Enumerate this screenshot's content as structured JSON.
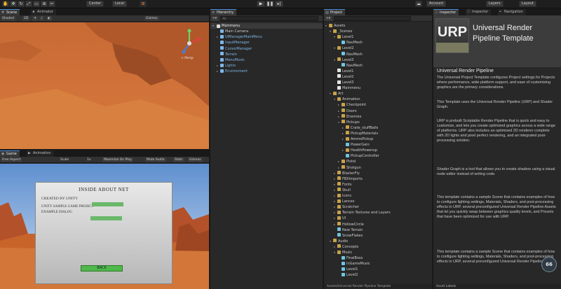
{
  "toolbar": {
    "left_buttons": [
      "Center",
      "Local"
    ],
    "right_buttons": [
      "Account",
      "Layers",
      "Layout"
    ]
  },
  "scene_panel": {
    "tabs": [
      "Scene",
      "Animator"
    ],
    "subbar": [
      "Shaded",
      "2D",
      "Gizmos"
    ],
    "gizmo_label": "< Persp"
  },
  "game_panel": {
    "tabs": [
      "Game",
      "Animation"
    ],
    "subbar": [
      "Free Aspect",
      "Scale",
      "1x",
      "Maximize On Play",
      "Mute Audio",
      "Stats",
      "Gizmos"
    ],
    "dialog": {
      "title": "INSIDE ABOUT NET",
      "line1": "CREATED BY UNITY",
      "line2": "UNITY SAMPLE GAME PROJECT",
      "line3": "EXAMPLE DIALOG",
      "button": "BACK"
    }
  },
  "hierarchy": {
    "tab": "Hierarchy",
    "search_placeholder": "All",
    "scene_name": "Mainmenu",
    "items": [
      {
        "label": "Main Camera",
        "depth": 1,
        "icon": "go",
        "arrow": ""
      },
      {
        "label": "UIManagerMainMenu",
        "depth": 1,
        "icon": "go",
        "arrow": "▸"
      },
      {
        "label": "InputManager",
        "depth": 1,
        "icon": "go",
        "arrow": ""
      },
      {
        "label": "CursorManager",
        "depth": 1,
        "icon": "go",
        "arrow": ""
      },
      {
        "label": "Terrain",
        "depth": 1,
        "icon": "go",
        "arrow": ""
      },
      {
        "label": "MenuMusic",
        "depth": 1,
        "icon": "go",
        "arrow": ""
      },
      {
        "label": "Lights",
        "depth": 1,
        "icon": "go",
        "arrow": "▸"
      },
      {
        "label": "Environment",
        "depth": 1,
        "icon": "go",
        "arrow": "▸"
      }
    ]
  },
  "project": {
    "tab": "Project",
    "items": [
      {
        "label": "Assets",
        "depth": 0,
        "icon": "folder",
        "arrow": "▾"
      },
      {
        "label": "_Scenes",
        "depth": 1,
        "icon": "folder",
        "arrow": "▾"
      },
      {
        "label": "Level1",
        "depth": 2,
        "icon": "folder",
        "arrow": "▾"
      },
      {
        "label": "NavMesh",
        "depth": 3,
        "icon": "asset",
        "arrow": ""
      },
      {
        "label": "Level2",
        "depth": 2,
        "icon": "folder",
        "arrow": "▾"
      },
      {
        "label": "NavMesh",
        "depth": 3,
        "icon": "asset",
        "arrow": ""
      },
      {
        "label": "Level3",
        "depth": 2,
        "icon": "folder",
        "arrow": "▾"
      },
      {
        "label": "NavMesh",
        "depth": 3,
        "icon": "asset",
        "arrow": ""
      },
      {
        "label": "Level1",
        "depth": 2,
        "icon": "scenefile",
        "arrow": ""
      },
      {
        "label": "Level2",
        "depth": 2,
        "icon": "scenefile",
        "arrow": ""
      },
      {
        "label": "Level3",
        "depth": 2,
        "icon": "scenefile",
        "arrow": ""
      },
      {
        "label": "Mainmenu",
        "depth": 2,
        "icon": "scenefile",
        "arrow": ""
      },
      {
        "label": "Art",
        "depth": 1,
        "icon": "folder",
        "arrow": "▾"
      },
      {
        "label": "Animation",
        "depth": 2,
        "icon": "folder",
        "arrow": "▾"
      },
      {
        "label": "Checkpoint",
        "depth": 3,
        "icon": "folder",
        "arrow": "▸"
      },
      {
        "label": "Doors",
        "depth": 3,
        "icon": "folder",
        "arrow": "▸"
      },
      {
        "label": "Enemies",
        "depth": 3,
        "icon": "folder",
        "arrow": "▸"
      },
      {
        "label": "Pickups",
        "depth": 3,
        "icon": "folder",
        "arrow": "▾"
      },
      {
        "label": "Crate_stuffBalls",
        "depth": 4,
        "icon": "folder",
        "arrow": "▸"
      },
      {
        "label": "PickupMaterials",
        "depth": 4,
        "icon": "folder",
        "arrow": "▸"
      },
      {
        "label": "AmmoPickup",
        "depth": 4,
        "icon": "folder",
        "arrow": "▸"
      },
      {
        "label": "PowerGain",
        "depth": 4,
        "icon": "asset",
        "arrow": ""
      },
      {
        "label": "HealthPowerup",
        "depth": 4,
        "icon": "folder",
        "arrow": "▸"
      },
      {
        "label": "PickupController",
        "depth": 4,
        "icon": "asset",
        "arrow": ""
      },
      {
        "label": "Pistol",
        "depth": 3,
        "icon": "folder",
        "arrow": "▸"
      },
      {
        "label": "Shotgun",
        "depth": 3,
        "icon": "folder",
        "arrow": "▸"
      },
      {
        "label": "BlasterFly",
        "depth": 2,
        "icon": "folder",
        "arrow": "▸"
      },
      {
        "label": "FBXImports",
        "depth": 2,
        "icon": "folder",
        "arrow": "▸"
      },
      {
        "label": "Fonts",
        "depth": 2,
        "icon": "folder",
        "arrow": "▸"
      },
      {
        "label": "Skull",
        "depth": 2,
        "icon": "folder",
        "arrow": "▸"
      },
      {
        "label": "Icons",
        "depth": 2,
        "icon": "folder",
        "arrow": "▸"
      },
      {
        "label": "Lances",
        "depth": 2,
        "icon": "folder",
        "arrow": "▸"
      },
      {
        "label": "Scratcher",
        "depth": 2,
        "icon": "folder",
        "arrow": "▸"
      },
      {
        "label": "Terrain Textures and Layers",
        "depth": 2,
        "icon": "folder",
        "arrow": "▸"
      },
      {
        "label": "UI",
        "depth": 2,
        "icon": "folder",
        "arrow": "▸"
      },
      {
        "label": "HollowCircle",
        "depth": 2,
        "icon": "folder",
        "arrow": "▸"
      },
      {
        "label": "New Terrain",
        "depth": 2,
        "icon": "asset",
        "arrow": ""
      },
      {
        "label": "SnowFlakes",
        "depth": 2,
        "icon": "asset",
        "arrow": ""
      },
      {
        "label": "Audio",
        "depth": 1,
        "icon": "folder",
        "arrow": "▾"
      },
      {
        "label": "Concepts",
        "depth": 2,
        "icon": "folder",
        "arrow": "▸"
      },
      {
        "label": "Music",
        "depth": 2,
        "icon": "folder",
        "arrow": "▾"
      },
      {
        "label": "FinalBoss",
        "depth": 3,
        "icon": "asset",
        "arrow": ""
      },
      {
        "label": "InGameMusic",
        "depth": 3,
        "icon": "asset",
        "arrow": ""
      },
      {
        "label": "Level1",
        "depth": 3,
        "icon": "asset",
        "arrow": ""
      },
      {
        "label": "Level2",
        "depth": 3,
        "icon": "asset",
        "arrow": ""
      }
    ],
    "footer": "Assets/Universal Render Pipeline Template"
  },
  "inspector": {
    "tabs": [
      "Inspector",
      "Inspector",
      "Navigation"
    ],
    "header_title_1": "Universal Render",
    "header_title_2": "Pipeline Template",
    "logo_text": "URP",
    "heading": "Universal Render Pipeline",
    "paragraphs": [
      "The Universal Project Template configures Project settings for Projects where performance, wide platform support, and ease of customizing graphics are the primary considerations.",
      "This Template uses the Universal Render Pipeline (URP) and Shader Graph.",
      "URP is prebuilt Scriptable Render Pipeline that is quick and easy to customize, and lets you create optimized graphics across a wide range of platforms. URP also includes an optimized 2D renderer complete with 2D lights and pixel perfect rendering, and an integrated post-processing solution.",
      "Shader Graph is a tool that allows you to create shaders using a visual node editor instead of writing code.",
      "This template contains a sample Scene that contains examples of how to configure lighting settings, Materials, Shaders, and post-processing effects in URP, several preconfigured Universal Render Pipeline Assets that let you quickly swap between graphics quality levels, and Presets that have been optimized for use with URP.",
      "This template contains a sample Scene that contains examples of how to configure lighting settings, Materials, Shaders, and post-processing effects in URP, several preconfigured Universal Render Pipeline Assets"
    ],
    "footer": "Asset Labels",
    "badge": "66"
  },
  "colors": {
    "accent": "#4a8ad8",
    "desert": "#c8642a",
    "sky": "#7fa8d8"
  }
}
